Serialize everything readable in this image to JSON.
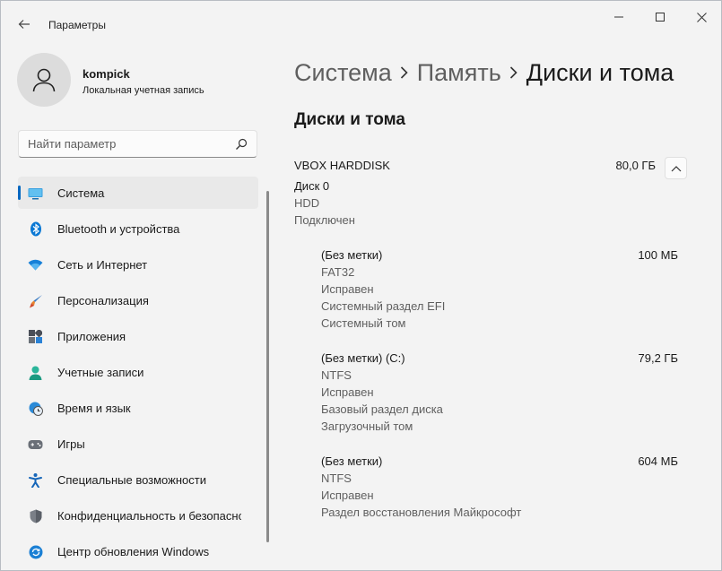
{
  "window": {
    "title": "Параметры",
    "controls": {
      "minimize_icon": "minimize-icon",
      "maximize_icon": "maximize-icon",
      "close_icon": "close-icon"
    }
  },
  "profile": {
    "name": "kompick",
    "account_type": "Локальная учетная запись"
  },
  "search": {
    "placeholder": "Найти параметр",
    "value": ""
  },
  "sidebar": {
    "items": [
      {
        "label": "Система",
        "icon": "system-icon",
        "active": true
      },
      {
        "label": "Bluetooth и устройства",
        "icon": "bluetooth-icon"
      },
      {
        "label": "Сеть и Интернет",
        "icon": "wifi-icon"
      },
      {
        "label": "Персонализация",
        "icon": "brush-icon"
      },
      {
        "label": "Приложения",
        "icon": "apps-icon"
      },
      {
        "label": "Учетные записи",
        "icon": "accounts-icon"
      },
      {
        "label": "Время и язык",
        "icon": "time-language-icon"
      },
      {
        "label": "Игры",
        "icon": "gamepad-icon"
      },
      {
        "label": "Специальные возможности",
        "icon": "accessibility-icon"
      },
      {
        "label": "Конфиденциальность и безопасность",
        "icon": "shield-icon"
      },
      {
        "label": "Центр обновления Windows",
        "icon": "update-icon"
      }
    ]
  },
  "breadcrumb": [
    "Система",
    "Память",
    "Диски и тома"
  ],
  "main": {
    "section_title": "Диски и тома",
    "disk": {
      "name": "VBOX HARDDISK",
      "size": "80,0 ГБ",
      "number": "Диск 0",
      "media_type": "HDD",
      "status": "Подключен"
    },
    "partitions": [
      {
        "name": "(Без метки)",
        "size": "100 МБ",
        "lines": [
          "FAT32",
          "Исправен",
          "Системный раздел EFI",
          "Системный том"
        ]
      },
      {
        "name": "(Без метки) (C:)",
        "size": "79,2 ГБ",
        "lines": [
          "NTFS",
          "Исправен",
          "Базовый раздел диска",
          "Загрузочный том"
        ]
      },
      {
        "name": "(Без метки)",
        "size": "604 МБ",
        "lines": [
          "NTFS",
          "Исправен",
          "Раздел восстановления Майкрософт"
        ]
      }
    ]
  },
  "colors": {
    "accent": "#0067c0",
    "background": "#f3f3f3",
    "secondary_text": "#5f5f5f"
  }
}
